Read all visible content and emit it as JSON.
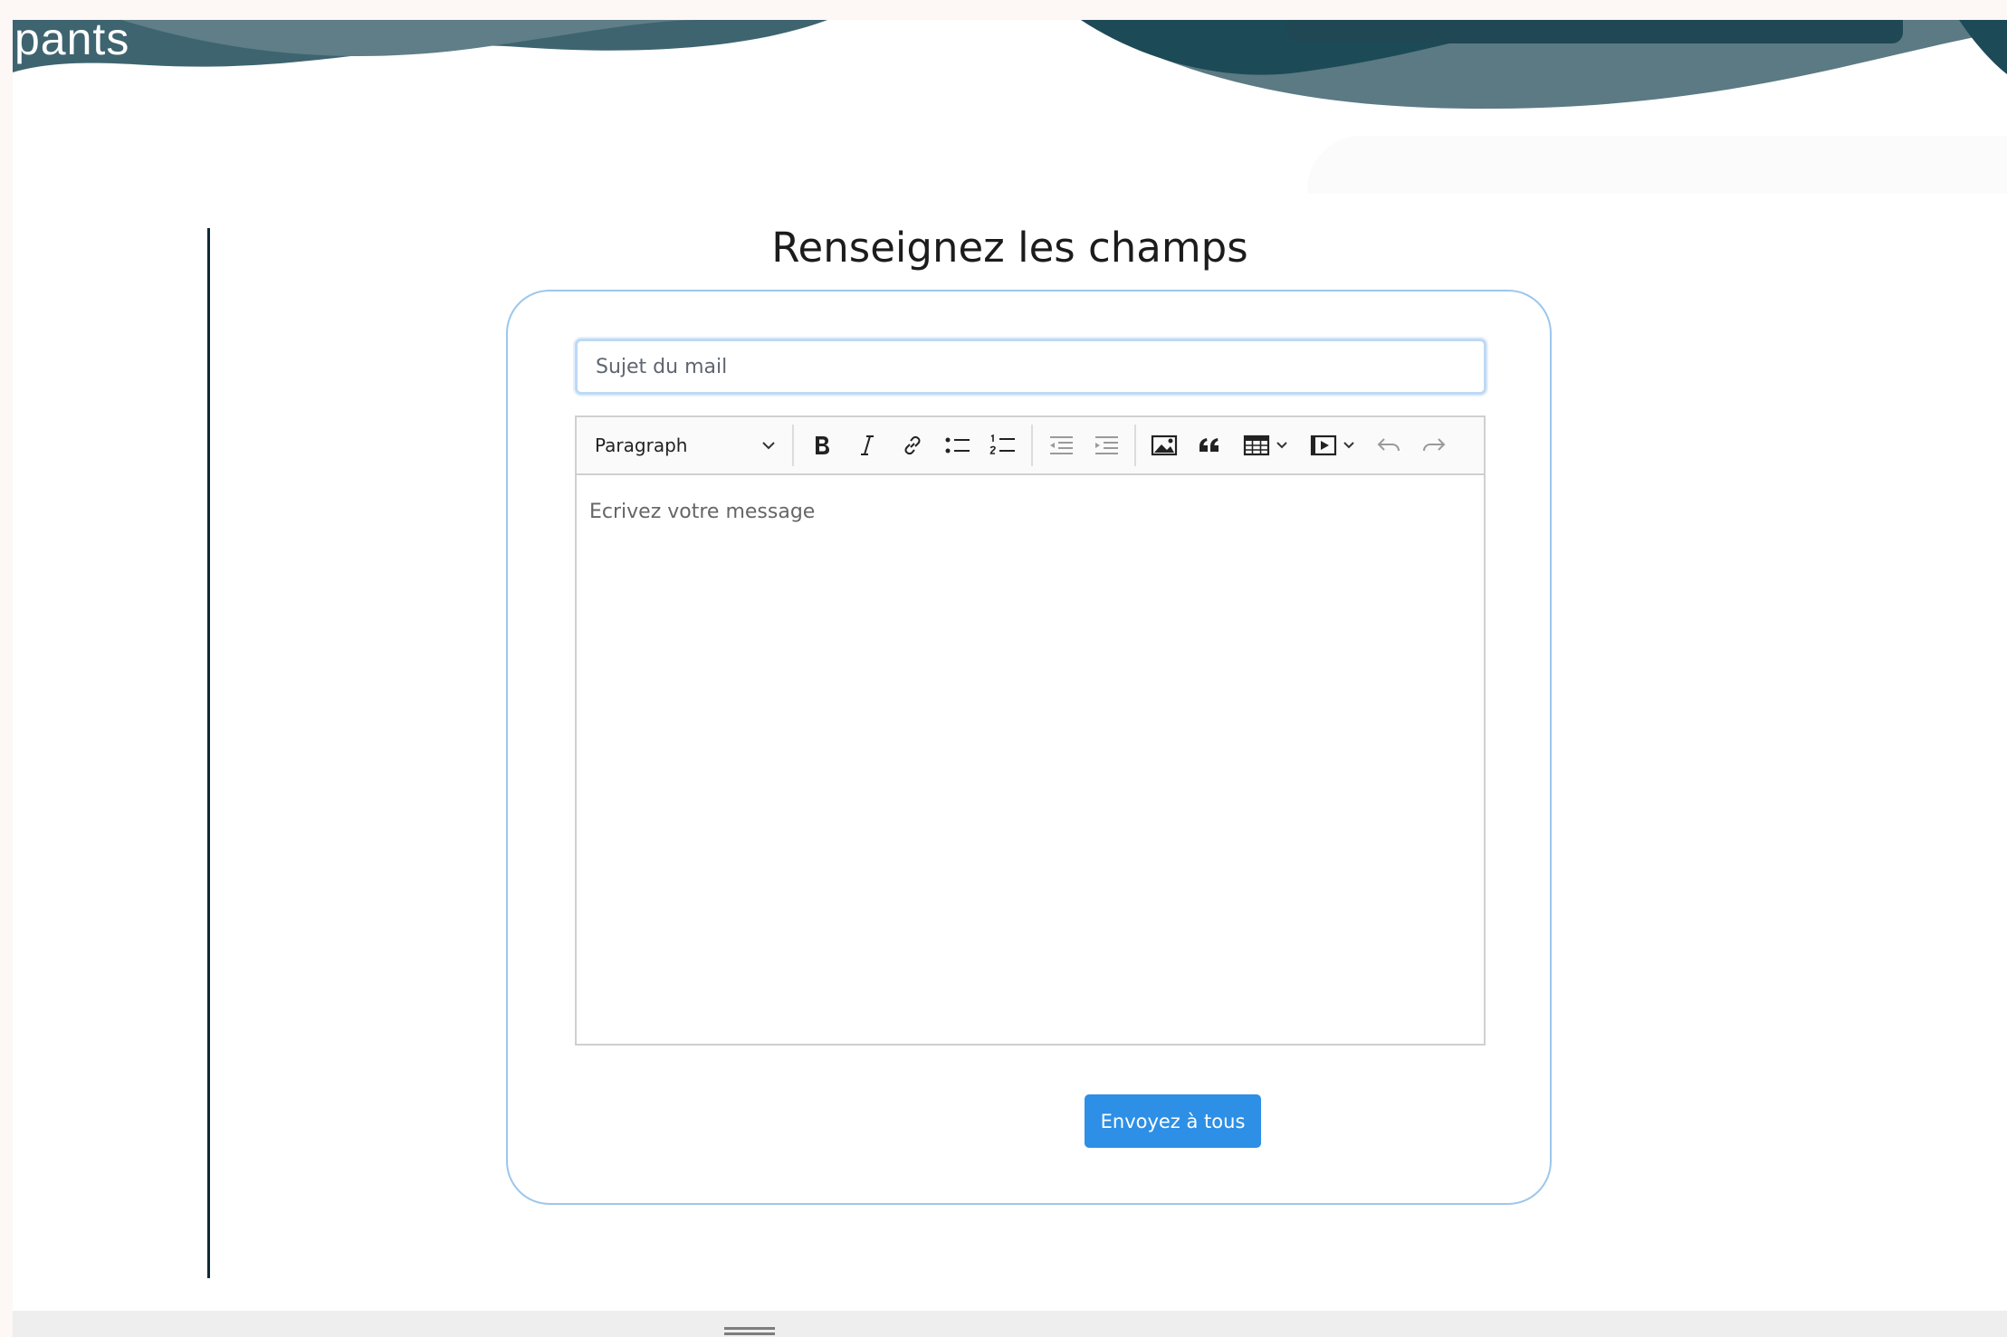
{
  "header": {
    "brand_fragment": "pants",
    "wave_colors": {
      "dark": "#1b4552",
      "mid": "#55737c",
      "light": "#7f979f"
    }
  },
  "form": {
    "title": "Renseignez les champs",
    "subject_placeholder": "Sujet du mail",
    "editor": {
      "format_select": "Paragraph",
      "toolbar_icons": [
        "bold-icon",
        "italic-icon",
        "link-icon",
        "bulleted-list-icon",
        "numbered-list-icon",
        "outdent-icon",
        "indent-icon",
        "image-icon",
        "blockquote-icon",
        "table-icon",
        "media-embed-icon",
        "undo-icon",
        "redo-icon"
      ],
      "message_placeholder": "Ecrivez votre message"
    },
    "submit_label": "Envoyez à tous",
    "accent_color": "#2d8fe6",
    "card_border_color": "#9cc7ec"
  }
}
